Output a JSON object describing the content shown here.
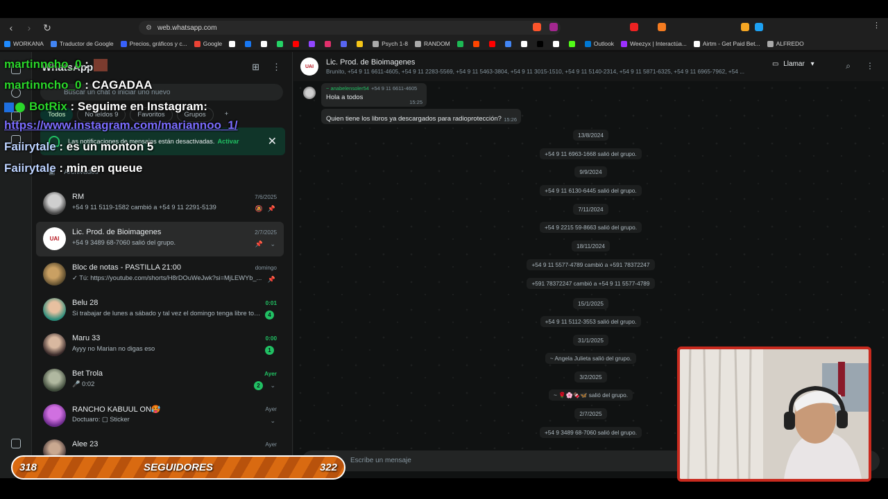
{
  "browser": {
    "url": "web.whatsapp.com",
    "bookmarks": [
      {
        "label": "WORKANA",
        "color": "#1f8bff"
      },
      {
        "label": "Traductor de Google",
        "color": "#4285f4"
      },
      {
        "label": "Precios, gráficos y c...",
        "color": "#3861fb"
      },
      {
        "label": "Google",
        "color": "#ea4335"
      },
      {
        "label": "",
        "color": "#ffffff"
      },
      {
        "label": "",
        "color": "#1877f2"
      },
      {
        "label": "",
        "color": "#ffffff"
      },
      {
        "label": "",
        "color": "#25d366"
      },
      {
        "label": "",
        "color": "#ff0000"
      },
      {
        "label": "",
        "color": "#9146ff"
      },
      {
        "label": "",
        "color": "#e1306c"
      },
      {
        "label": "",
        "color": "#5865f2"
      },
      {
        "label": "",
        "color": "#f5c518"
      },
      {
        "label": "Psych 1-8",
        "color": "#aaaaaa"
      },
      {
        "label": "RANDOM",
        "color": "#aaaaaa"
      },
      {
        "label": "",
        "color": "#1db954"
      },
      {
        "label": "",
        "color": "#ff4500"
      },
      {
        "label": "",
        "color": "#ff0000"
      },
      {
        "label": "",
        "color": "#4285f4"
      },
      {
        "label": "",
        "color": "#ffffff"
      },
      {
        "label": "",
        "color": "#000000"
      },
      {
        "label": "",
        "color": "#ffffff"
      },
      {
        "label": "",
        "color": "#53fc18"
      },
      {
        "label": "Outlook",
        "color": "#0078d4"
      },
      {
        "label": "Weezyx | Interactúa...",
        "color": "#9b30ff"
      },
      {
        "label": "Airtm - Get Paid Bet...",
        "color": "#ffffff"
      },
      {
        "label": "ALFREDO",
        "color": "#aaaaaa"
      }
    ]
  },
  "sidebar": {
    "title": "WhatsApp",
    "search_placeholder": "Buscar un chat o iniciar uno nuevo",
    "filters": [
      "Todos",
      "No leídos 9",
      "Favoritos",
      "Grupos"
    ],
    "notification": {
      "text": "Las notificaciones de mensajes están desactivadas.",
      "action": "Activar"
    },
    "archived_label": "Archivados",
    "chats": [
      {
        "name": "RM",
        "preview": "+54 9 11 5119-1582 cambió a +54 9 11 2291-5139",
        "time": "7/6/2025",
        "badge": ""
      },
      {
        "name": "Lic. Prod. de Bioimagenes",
        "preview": "+54 9 3489 68-7060 salió del grupo.",
        "time": "2/7/2025",
        "badge": ""
      },
      {
        "name": "Bloc de notas - PASTILLA 21:00",
        "preview": "✓ Tú: https://youtube.com/shorts/H8rDOuWeJwk?si=MjLEWYb_...",
        "time": "domingo",
        "badge": ""
      },
      {
        "name": "Belu 28",
        "preview": "Si trabajar de lunes a sábado y tal vez el domingo tenga libre todo...",
        "time": "0:01",
        "badge": "4"
      },
      {
        "name": "Maru 33",
        "preview": "Ayyy no Marian no digas eso",
        "time": "0:00",
        "badge": "1"
      },
      {
        "name": "Bet Trola",
        "preview": "🎤 0:02",
        "time": "Ayer",
        "badge": "2"
      },
      {
        "name": "RANCHO KABUUL ON🥵",
        "preview": "Doctuaro: ▢ Sticker",
        "time": "Ayer",
        "badge": ""
      },
      {
        "name": "Alee 23",
        "preview": "",
        "time": "Ayer",
        "badge": ""
      }
    ]
  },
  "conversation": {
    "group_name": "Lic. Prod. de Bioimagenes",
    "avatar_text": "UAI",
    "members": "Brunito, +54 9 11 6611-4605, +54 9 11 2283-5569, +54 9 11 5463-3804, +54 9 11 3015-1510, +54 9 11 5140-2314, +54 9 11 5871-6325, +54 9 11 6965-7962, +54 ...",
    "call_label": "Llamar",
    "messages": [
      {
        "sender": "~ anabelensoler54",
        "number": "+54 9 11 6611-4605",
        "text": "Hola a todos",
        "time": "15:25"
      },
      {
        "sender": "",
        "number": "",
        "text": "Quien tiene los libros ya descargados para radioprotección?",
        "time": "15:26"
      }
    ],
    "system": [
      {
        "date": "13/8/2024",
        "event": "+54 9 11 6963-1668 salió del grupo."
      },
      {
        "date": "9/9/2024",
        "event": "+54 9 11 6130-6445 salió del grupo."
      },
      {
        "date": "7/11/2024",
        "event": "+54 9 2215 59-8663 salió del grupo."
      },
      {
        "date": "18/11/2024",
        "event": "+54 9 11 5577-4789 cambió a +591 78372247"
      },
      {
        "date": "",
        "event": "+591 78372247 cambió a +54 9 11 5577-4789"
      },
      {
        "date": "15/1/2025",
        "event": "+54 9 11 5112-3553 salió del grupo."
      },
      {
        "date": "31/1/2025",
        "event": "~ Angela Julieta salió del grupo."
      },
      {
        "date": "3/2/2025",
        "event": "~ 🌹🌸🍫🦋 salió del grupo."
      },
      {
        "date": "2/7/2025",
        "event": "+54 9 3489 68-7060 salió del grupo."
      }
    ],
    "composer_placeholder": "Escribe un mensaje"
  },
  "stream_chat": [
    {
      "user": "martinncho_0",
      "sep": " : ",
      "message": "",
      "link": ""
    },
    {
      "user": "martinncho_0",
      "sep": " : ",
      "message": "CAGADAA",
      "link": ""
    },
    {
      "user": "BotRix",
      "sep": " : ",
      "message": "Seguime en Instagram:",
      "link": ""
    },
    {
      "user": "",
      "sep": "",
      "message": "",
      "link": "https://www.instagram.com/mariannoo_1/"
    },
    {
      "user": "Faiirytale",
      "sep": " : ",
      "message": "es un monton 5",
      "link": ""
    },
    {
      "user": "Faiirytale",
      "sep": " : ",
      "message": "min en queue",
      "link": ""
    }
  ],
  "followers": {
    "current": "318",
    "label": "SEGUIDORES",
    "goal": "322"
  },
  "colors": {
    "accent": "#21c063",
    "overlay_border": "#c92a1e",
    "follow_bar": "#d96a11"
  }
}
